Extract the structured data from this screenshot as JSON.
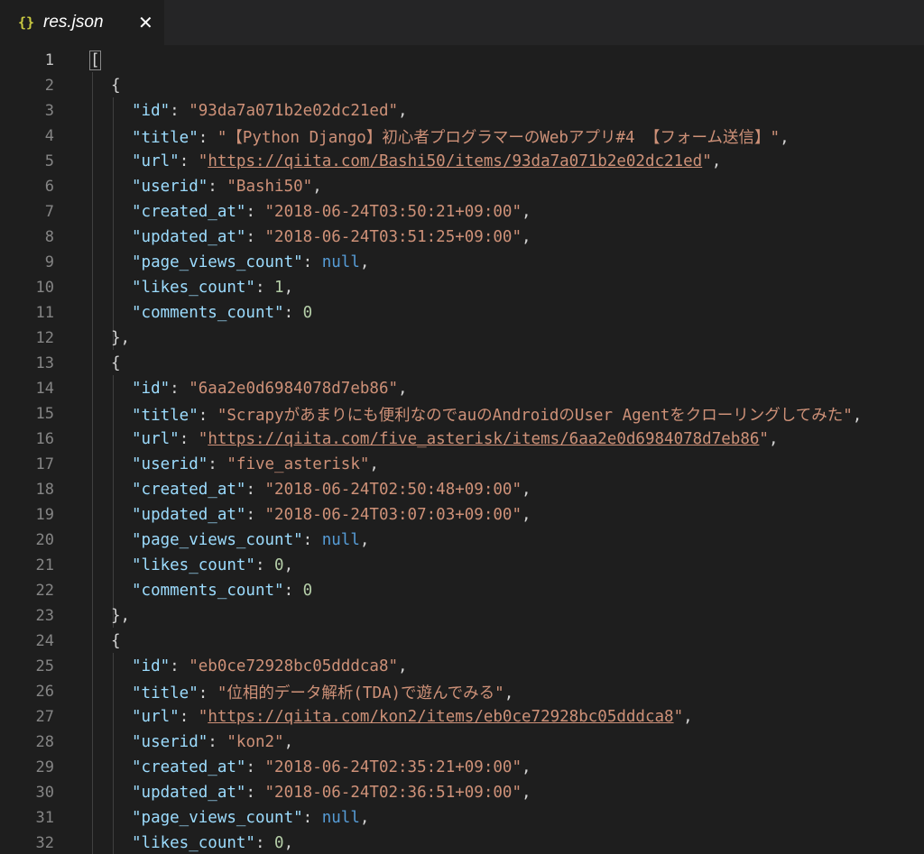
{
  "tab": {
    "icon": "{}",
    "title": "res.json",
    "close": "✕"
  },
  "lines": [
    {
      "n": "1",
      "indent": 0,
      "type": "open_arr",
      "text": "["
    },
    {
      "n": "2",
      "indent": 1,
      "type": "punct",
      "text": "{"
    },
    {
      "n": "3",
      "indent": 2,
      "type": "kv",
      "key": "\"id\"",
      "val": "\"93da7a071b2e02dc21ed\"",
      "vtype": "s",
      "comma": ","
    },
    {
      "n": "4",
      "indent": 2,
      "type": "kv",
      "key": "\"title\"",
      "val": "\"【Python Django】初心者プログラマーのWebアプリ#4 【フォーム送信】\"",
      "vtype": "s",
      "comma": ","
    },
    {
      "n": "5",
      "indent": 2,
      "type": "kv_url",
      "key": "\"url\"",
      "val": "https://qiita.com/Bashi50/items/93da7a071b2e02dc21ed",
      "comma": ","
    },
    {
      "n": "6",
      "indent": 2,
      "type": "kv",
      "key": "\"userid\"",
      "val": "\"Bashi50\"",
      "vtype": "s",
      "comma": ","
    },
    {
      "n": "7",
      "indent": 2,
      "type": "kv",
      "key": "\"created_at\"",
      "val": "\"2018-06-24T03:50:21+09:00\"",
      "vtype": "s",
      "comma": ","
    },
    {
      "n": "8",
      "indent": 2,
      "type": "kv",
      "key": "\"updated_at\"",
      "val": "\"2018-06-24T03:51:25+09:00\"",
      "vtype": "s",
      "comma": ","
    },
    {
      "n": "9",
      "indent": 2,
      "type": "kv",
      "key": "\"page_views_count\"",
      "val": "null",
      "vtype": "kw",
      "comma": ","
    },
    {
      "n": "10",
      "indent": 2,
      "type": "kv",
      "key": "\"likes_count\"",
      "val": "1",
      "vtype": "n",
      "comma": ","
    },
    {
      "n": "11",
      "indent": 2,
      "type": "kv",
      "key": "\"comments_count\"",
      "val": "0",
      "vtype": "n",
      "comma": ""
    },
    {
      "n": "12",
      "indent": 1,
      "type": "punct",
      "text": "},"
    },
    {
      "n": "13",
      "indent": 1,
      "type": "punct",
      "text": "{"
    },
    {
      "n": "14",
      "indent": 2,
      "type": "kv",
      "key": "\"id\"",
      "val": "\"6aa2e0d6984078d7eb86\"",
      "vtype": "s",
      "comma": ","
    },
    {
      "n": "15",
      "indent": 2,
      "type": "kv",
      "key": "\"title\"",
      "val": "\"Scrapyがあまりにも便利なのでauのAndroidのUser Agentをクローリングしてみた\"",
      "vtype": "s",
      "comma": ","
    },
    {
      "n": "16",
      "indent": 2,
      "type": "kv_url",
      "key": "\"url\"",
      "val": "https://qiita.com/five_asterisk/items/6aa2e0d6984078d7eb86",
      "comma": ","
    },
    {
      "n": "17",
      "indent": 2,
      "type": "kv",
      "key": "\"userid\"",
      "val": "\"five_asterisk\"",
      "vtype": "s",
      "comma": ","
    },
    {
      "n": "18",
      "indent": 2,
      "type": "kv",
      "key": "\"created_at\"",
      "val": "\"2018-06-24T02:50:48+09:00\"",
      "vtype": "s",
      "comma": ","
    },
    {
      "n": "19",
      "indent": 2,
      "type": "kv",
      "key": "\"updated_at\"",
      "val": "\"2018-06-24T03:07:03+09:00\"",
      "vtype": "s",
      "comma": ","
    },
    {
      "n": "20",
      "indent": 2,
      "type": "kv",
      "key": "\"page_views_count\"",
      "val": "null",
      "vtype": "kw",
      "comma": ","
    },
    {
      "n": "21",
      "indent": 2,
      "type": "kv",
      "key": "\"likes_count\"",
      "val": "0",
      "vtype": "n",
      "comma": ","
    },
    {
      "n": "22",
      "indent": 2,
      "type": "kv",
      "key": "\"comments_count\"",
      "val": "0",
      "vtype": "n",
      "comma": ""
    },
    {
      "n": "23",
      "indent": 1,
      "type": "punct",
      "text": "},"
    },
    {
      "n": "24",
      "indent": 1,
      "type": "punct",
      "text": "{"
    },
    {
      "n": "25",
      "indent": 2,
      "type": "kv",
      "key": "\"id\"",
      "val": "\"eb0ce72928bc05dddca8\"",
      "vtype": "s",
      "comma": ","
    },
    {
      "n": "26",
      "indent": 2,
      "type": "kv",
      "key": "\"title\"",
      "val": "\"位相的データ解析(TDA)で遊んでみる\"",
      "vtype": "s",
      "comma": ","
    },
    {
      "n": "27",
      "indent": 2,
      "type": "kv_url",
      "key": "\"url\"",
      "val": "https://qiita.com/kon2/items/eb0ce72928bc05dddca8",
      "comma": ","
    },
    {
      "n": "28",
      "indent": 2,
      "type": "kv",
      "key": "\"userid\"",
      "val": "\"kon2\"",
      "vtype": "s",
      "comma": ","
    },
    {
      "n": "29",
      "indent": 2,
      "type": "kv",
      "key": "\"created_at\"",
      "val": "\"2018-06-24T02:35:21+09:00\"",
      "vtype": "s",
      "comma": ","
    },
    {
      "n": "30",
      "indent": 2,
      "type": "kv",
      "key": "\"updated_at\"",
      "val": "\"2018-06-24T02:36:51+09:00\"",
      "vtype": "s",
      "comma": ","
    },
    {
      "n": "31",
      "indent": 2,
      "type": "kv",
      "key": "\"page_views_count\"",
      "val": "null",
      "vtype": "kw",
      "comma": ","
    },
    {
      "n": "32",
      "indent": 2,
      "type": "kv",
      "key": "\"likes_count\"",
      "val": "0",
      "vtype": "n",
      "comma": ","
    }
  ]
}
